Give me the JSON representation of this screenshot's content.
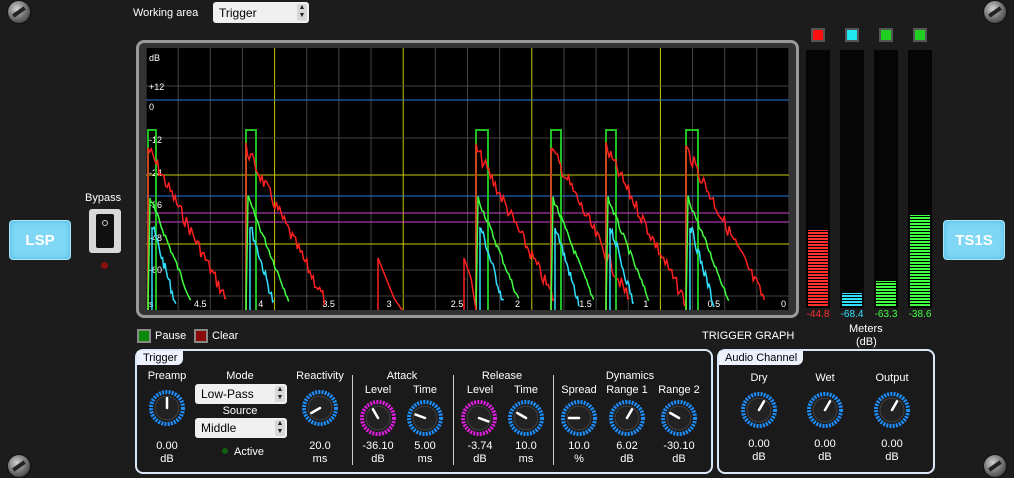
{
  "header": {
    "working_area_label": "Working area",
    "working_area_value": "Trigger"
  },
  "side": {
    "left_logo": "LSP",
    "right_logo": "TS1S",
    "bypass_label": "Bypass"
  },
  "graph": {
    "db_label": "dB",
    "y_labels": [
      "+12",
      "0",
      "-12",
      "-24",
      "-36",
      "-48",
      "-60"
    ],
    "x_labels": [
      "s",
      "4.5",
      "4",
      "3.5",
      "3",
      "2.5",
      "2",
      "1.5",
      "1",
      "0.5",
      "0"
    ],
    "title": "TRIGGER GRAPH"
  },
  "controls": {
    "pause_label": "Pause",
    "clear_label": "Clear"
  },
  "meters": {
    "title": "Meters",
    "unit": "(dB)",
    "values": [
      "-44.8",
      "-68.4",
      "-63.3",
      "-38.6"
    ],
    "colors": [
      "#ff3030",
      "#30e0ff",
      "#40ff40",
      "#40ff40"
    ],
    "levels": [
      0.3,
      0.05,
      0.1,
      0.36
    ]
  },
  "trigger": {
    "title": "Trigger",
    "preamp": {
      "label": "Preamp",
      "value": "0.00",
      "unit": "dB"
    },
    "mode": {
      "label": "Mode",
      "value": "Low-Pass"
    },
    "source": {
      "label": "Source",
      "value": "Middle"
    },
    "active_label": "Active",
    "reactivity": {
      "label": "Reactivity",
      "value": "20.0",
      "unit": "ms"
    },
    "attack": {
      "label": "Attack",
      "level_label": "Level",
      "time_label": "Time",
      "level_value": "-36.10",
      "level_unit": "dB",
      "time_value": "5.00",
      "time_unit": "ms"
    },
    "release": {
      "label": "Release",
      "level_label": "Level",
      "time_label": "Time",
      "level_value": "-3.74",
      "level_unit": "dB",
      "time_value": "10.0",
      "time_unit": "ms"
    },
    "dynamics": {
      "label": "Dynamics",
      "spread_label": "Spread",
      "range1_label": "Range 1",
      "range2_label": "Range 2",
      "spread_value": "10.0",
      "spread_unit": "%",
      "range1_value": "6.02",
      "range1_unit": "dB",
      "range2_value": "-30.10",
      "range2_unit": "dB"
    }
  },
  "audio_channel": {
    "title": "Audio Channel",
    "dry": {
      "label": "Dry",
      "value": "0.00",
      "unit": "dB"
    },
    "wet": {
      "label": "Wet",
      "value": "0.00",
      "unit": "dB"
    },
    "output": {
      "label": "Output",
      "value": "0.00",
      "unit": "dB"
    }
  }
}
